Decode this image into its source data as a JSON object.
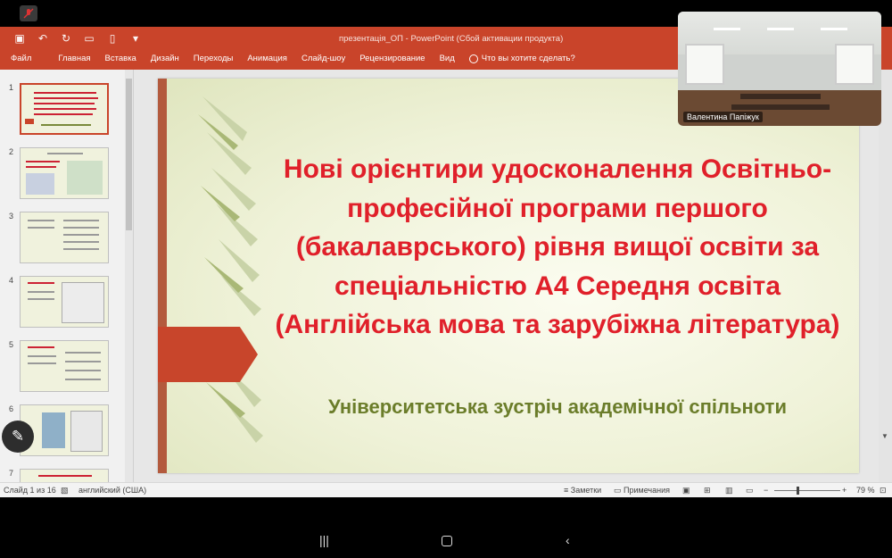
{
  "window": {
    "title": "презентація_ОП - PowerPoint (Сбой активации продукта)"
  },
  "menu": [
    "Файл",
    "Главная",
    "Вставка",
    "Дизайн",
    "Переходы",
    "Анимация",
    "Слайд-шоу",
    "Рецензирование",
    "Вид"
  ],
  "tell_me": "Что вы хотите сделать?",
  "slide": {
    "title": "Нові орієнтири удосконалення Освітньо-професійної програми першого (бакалаврського) рівня вищої освіти за спеціальністю А4 Середня освіта (Англійська мова та зарубіжна література)",
    "subtitle": "Університетська зустріч академічної спільноти"
  },
  "thumbnails": [
    "1",
    "2",
    "3",
    "4",
    "5",
    "6",
    "7"
  ],
  "status": {
    "slide_info": "Слайд 1 из 16",
    "language": "английский (США)",
    "notes": "Заметки",
    "comments": "Примечания",
    "zoom": "79 %"
  },
  "video": {
    "participant": "Валентина Папіжук"
  },
  "colors": {
    "ribbon": "#c9442a",
    "title_red": "#e0202a",
    "subtitle_green": "#6b7d2a"
  }
}
